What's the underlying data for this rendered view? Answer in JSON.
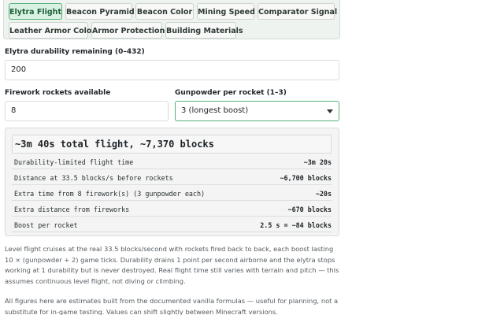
{
  "tabs": [
    {
      "label": "Elytra Flight",
      "active": true
    },
    {
      "label": "Beacon Pyramid",
      "active": false
    },
    {
      "label": "Beacon Color",
      "active": false
    },
    {
      "label": "Mining Speed",
      "active": false
    },
    {
      "label": "Comparator Signal",
      "active": false
    },
    {
      "label": "Leather Armor Color",
      "active": false
    },
    {
      "label": "Armor Protection",
      "active": false
    },
    {
      "label": "Building Materials",
      "active": false
    }
  ],
  "form": {
    "durability": {
      "label": "Elytra durability remaining (0–432)",
      "value": "200"
    },
    "rockets": {
      "label": "Firework rockets available",
      "value": "8"
    },
    "gunpowder": {
      "label": "Gunpowder per rocket (1–3)",
      "selected": "3 (longest boost)"
    }
  },
  "result": {
    "headline": "~3m 40s total flight, ~7,370 blocks",
    "rows": [
      {
        "label": "Durability-limited flight time",
        "value": "~3m 20s"
      },
      {
        "label": "Distance at 33.5 blocks/s before rockets",
        "value": "~6,700 blocks"
      },
      {
        "label": "Extra time from 8 firework(s) (3 gunpowder each)",
        "value": "~20s"
      },
      {
        "label": "Extra distance from fireworks",
        "value": "~670 blocks"
      },
      {
        "label": "Boost per rocket",
        "value": "2.5 s = ~84 blocks"
      }
    ]
  },
  "notes": {
    "explanation": "Level flight cruises at the real 33.5 blocks/second with rockets fired back to back, each boost lasting 10 × (gunpowder + 2) game ticks. Durability drains 1 point per second airborne and the elytra stops working at 1 durability but is never destroyed. Real flight time still varies with terrain and pitch — this assumes continuous level flight, not diving or climbing.",
    "disclaimer": "All figures here are estimates built from the documented vanilla formulas — useful for planning, not a substitute for in-game testing. Values can shift slightly between Minecraft versions."
  },
  "colors": {
    "accent": "#56b07b",
    "active_tab_bg": "#d9f2e3",
    "panel_bg": "#f3f4f3"
  }
}
